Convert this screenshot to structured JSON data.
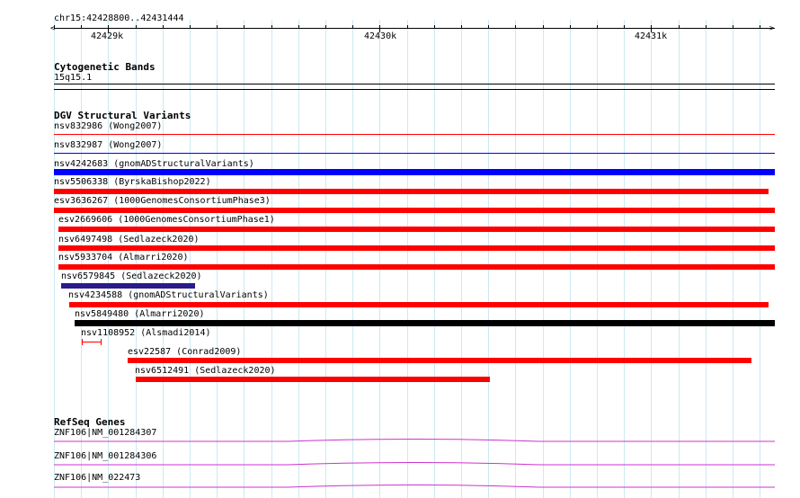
{
  "ruler": {
    "location": "chr15:42428800..42431444",
    "labels": [
      "42429k",
      "42430k",
      "42431k"
    ]
  },
  "cytoband": {
    "title": "Cytogenetic Bands",
    "band": "15q15.1"
  },
  "dgv": {
    "title": "DGV Structural Variants",
    "variants": [
      {
        "label": "nsv832986 (Wong2007)",
        "color": "#ff0000",
        "style": "thin"
      },
      {
        "label": "nsv832987 (Wong2007)",
        "color": "#0000ff",
        "style": "thin"
      },
      {
        "label": "nsv4242683 (gnomADStructuralVariants)",
        "color": "#0000ff",
        "style": "thick"
      },
      {
        "label": "nsv5506338 (ByrskaBishop2022)",
        "color": "#ff0000",
        "style": "thick"
      },
      {
        "label": "esv3636267 (1000GenomesConsortiumPhase3)",
        "color": "#ff0000",
        "style": "thick"
      },
      {
        "label": "esv2669606 (1000GenomesConsortiumPhase1)",
        "color": "#ff0000",
        "style": "thick"
      },
      {
        "label": "nsv6497498 (Sedlazeck2020)",
        "color": "#ff0000",
        "style": "thick"
      },
      {
        "label": "nsv5933704 (Almarri2020)",
        "color": "#ff0000",
        "style": "thick"
      },
      {
        "label": "nsv6579845 (Sedlazeck2020)",
        "color": "#2a1b8c",
        "style": "thick"
      },
      {
        "label": "nsv4234588 (gnomADStructuralVariants)",
        "color": "#ff0000",
        "style": "thick"
      },
      {
        "label": "nsv5849480 (Almarri2020)",
        "color": "#000000",
        "style": "thick"
      },
      {
        "label": "nsv1108952 (Alsmadi2014)",
        "color": "#ff0000",
        "style": "interval"
      },
      {
        "label": "esv22587 (Conrad2009)",
        "color": "#ff0000",
        "style": "thick"
      },
      {
        "label": "nsv6512491 (Sedlazeck2020)",
        "color": "#ff0000",
        "style": "thick"
      }
    ]
  },
  "refseq": {
    "title": "RefSeq Genes",
    "genes": [
      {
        "label": "ZNF106|NM_001284307",
        "color": "#cc33cc"
      },
      {
        "label": "ZNF106|NM_001284306",
        "color": "#cc33cc"
      },
      {
        "label": "ZNF106|NM_022473",
        "color": "#cc33cc"
      }
    ]
  }
}
